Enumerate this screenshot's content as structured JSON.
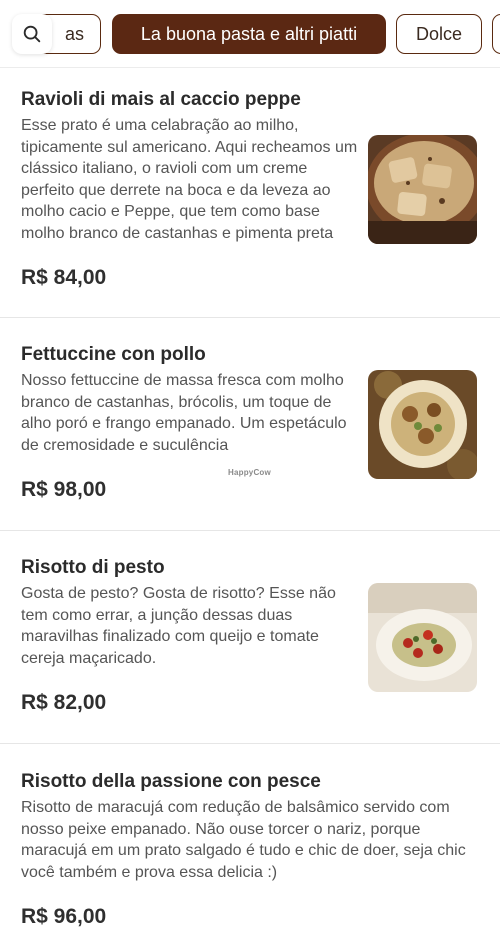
{
  "categories": {
    "previous_partial": "as",
    "active": "La buona pasta e altri piatti",
    "next": "Dolce"
  },
  "colors": {
    "accent": "#5b2813",
    "text": "#2b2b2b",
    "muted": "#555555"
  },
  "watermark": "HappyCow",
  "items": [
    {
      "name": "Ravioli di mais al caccio peppe",
      "description": "Esse prato é uma celabração ao milho, tipicamente sul americano. Aqui recheamos um clássico italiano, o ravioli com um creme perfeito que derrete na boca e da leveza ao molho cacio e Peppe, que tem como base molho branco de castanhas e pimenta preta",
      "price": "R$ 84,00"
    },
    {
      "name": "Fettuccine con pollo",
      "description": "Nosso fettuccine de massa fresca com molho branco de castanhas, brócolis, um toque de alho poró e frango empanado. Um espetáculo de cremosidade e suculência",
      "price": "R$ 98,00"
    },
    {
      "name": "Risotto di pesto",
      "description": "Gosta de pesto? Gosta de risotto? Esse não tem como errar, a junção dessas duas maravilhas finalizado com queijo e tomate cereja maçaricado.",
      "price": "R$ 82,00"
    },
    {
      "name": "Risotto della passione con pesce",
      "description": "Risotto de maracujá com redução de balsâmico servido com nosso peixe empanado. Não ouse torcer o nariz, porque maracujá em um prato salgado é tudo e chic de doer, seja chic você também e prova essa delicia :)",
      "price": "R$ 96,00"
    }
  ]
}
